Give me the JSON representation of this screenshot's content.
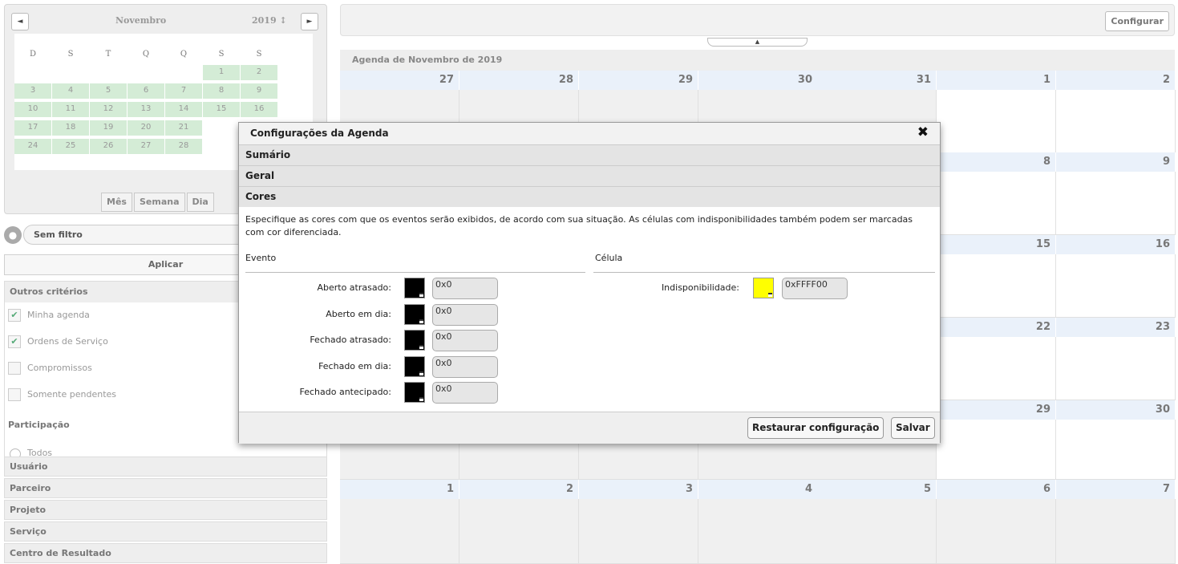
{
  "mini_calendar": {
    "month": "Novembro",
    "year": "2019 ↕",
    "prev_icon": "◄",
    "next_icon": "►",
    "days_of_week": [
      "D",
      "S",
      "T",
      "Q",
      "Q",
      "S",
      "S"
    ],
    "weeks": [
      [
        "",
        "",
        "",
        "",
        "",
        "1",
        "2"
      ],
      [
        "3",
        "4",
        "5",
        "6",
        "7",
        "8",
        "9"
      ],
      [
        "10",
        "11",
        "12",
        "13",
        "14",
        "15",
        "16"
      ],
      [
        "17",
        "18",
        "19",
        "20",
        "21",
        "",
        ""
      ],
      [
        "24",
        "25",
        "26",
        "27",
        "28",
        "",
        ""
      ]
    ],
    "view_buttons": [
      "Mês",
      "Semana",
      "Dia"
    ]
  },
  "filter": {
    "icon": "●",
    "value": "Sem filtro"
  },
  "apply_label": "Aplicar",
  "criteria": {
    "title": "Outros critérios",
    "checkboxes": [
      {
        "label": "Minha agenda",
        "checked": true
      },
      {
        "label": "Ordens de Serviço",
        "checked": true
      },
      {
        "label": "Compromissos",
        "checked": false
      },
      {
        "label": "Somente pendentes",
        "checked": false
      }
    ],
    "participation_title": "Participação",
    "participation_option": "Todos"
  },
  "filter_bars": [
    "Usuário",
    "Parceiro",
    "Projeto",
    "Serviço",
    "Centro de Resultado"
  ],
  "toolbar": {
    "configure_label": "Configurar",
    "collapse_icon": "▲"
  },
  "agenda": {
    "title": "Agenda de Novembro de 2019",
    "weeks": [
      [
        "27",
        "28",
        "29",
        "30",
        "31",
        "1",
        "2"
      ],
      [
        "",
        "",
        "",
        "",
        "",
        "8",
        "9"
      ],
      [
        "",
        "",
        "",
        "",
        "",
        "15",
        "16"
      ],
      [
        "",
        "",
        "",
        "",
        "",
        "22",
        "23"
      ],
      [
        "",
        "",
        "",
        "",
        "",
        "29",
        "30"
      ],
      [
        "1",
        "2",
        "3",
        "4",
        "5",
        "6",
        "7"
      ]
    ]
  },
  "modal": {
    "title": "Configurações da Agenda",
    "close_icon": "✖",
    "sections": [
      "Sumário",
      "Geral",
      "Cores"
    ],
    "description": "Especifique as cores com que os eventos serão exibidos, de acordo com sua situação. As células com indisponibilidades também podem ser marcadas com cor diferenciada.",
    "event_group": "Evento",
    "cell_group": "Célula",
    "event_colors": [
      {
        "label": "Aberto atrasado:",
        "value": "0x0",
        "color": "#000000"
      },
      {
        "label": "Aberto em dia:",
        "value": "0x0",
        "color": "#000000"
      },
      {
        "label": "Fechado atrasado:",
        "value": "0x0",
        "color": "#000000"
      },
      {
        "label": "Fechado em dia:",
        "value": "0x0",
        "color": "#000000"
      },
      {
        "label": "Fechado antecipado:",
        "value": "0x0",
        "color": "#000000"
      }
    ],
    "cell_colors": [
      {
        "label": "Indisponibilidade:",
        "value": "0xFFFF00",
        "color": "#FFFF00"
      }
    ],
    "restore_label": "Restaurar configuração",
    "save_label": "Salvar"
  }
}
